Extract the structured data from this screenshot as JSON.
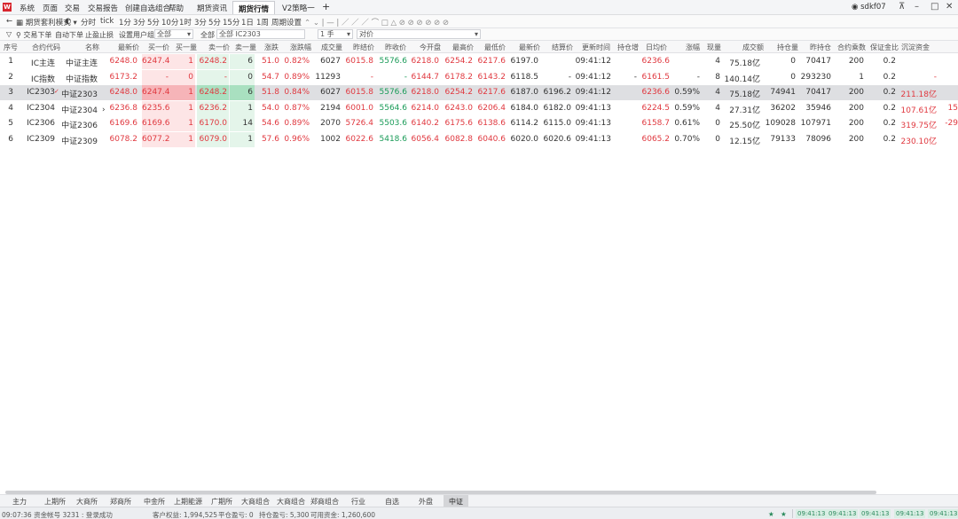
{
  "menubar": {
    "items": [
      "系统",
      "页面",
      "交易",
      "交易报告",
      "创建自选组合",
      "帮助",
      "期货资讯"
    ],
    "active_tab": "期货行情",
    "extra_tab": "V2策略一",
    "plus": "+",
    "user": "sdkf07",
    "pin_icon": "pin-icon",
    "min": "–",
    "max": "□",
    "close": "✕"
  },
  "toolbar": {
    "back": "←",
    "mode": "期货套利模式",
    "items": [
      "分时",
      "tick",
      "1分",
      "3分",
      "5分",
      "10分",
      "1时",
      "3分",
      "5分",
      "15分",
      "1日",
      "1周",
      "周期设置"
    ],
    "icons": "⌃ ⌄ | — | ／ ／ ／ ⌒ □ △ ⊘ ⊘ ⊘ ⊘ ⊘ ⊘"
  },
  "filterbar": {
    "items": [
      "交易下单",
      "自动下单",
      "止盈止损",
      "设置用户组"
    ],
    "group_value": "全部",
    "search_label": "全部",
    "search_prefix": "全部",
    "search_value": "IC2303",
    "lots_value": "1 手",
    "order_type": "对价"
  },
  "table": {
    "headers": [
      "序号",
      "合约代码",
      "名称",
      "最新价",
      "买一价",
      "买一量",
      "卖一价",
      "卖一量",
      "涨跌",
      "涨跌幅",
      "成交量",
      "昨结价",
      "昨收价",
      "今开盘",
      "最高价",
      "最低价",
      "最新价",
      "结算价",
      "更新时间",
      "持仓增",
      "日均价",
      "涨幅",
      "现量",
      "成交额",
      "持仓量",
      "昨持仓",
      "合约乘数",
      "保证金比",
      "沉淀资金"
    ],
    "rows": [
      {
        "idx": "1",
        "code": "IC主连",
        "name": "中证主连",
        "last": "6248.0",
        "bid": "6247.4",
        "bidv": "1",
        "ask": "6248.2",
        "askv": "6",
        "chg": "51.0",
        "pct": "0.82%",
        "vol": "6027",
        "presettle": "6015.8",
        "preclose": "5576.6",
        "open": "6218.0",
        "high": "6254.2",
        "low": "6217.6",
        "lastb": "6197.0",
        "settle": "",
        "time": "09:41:12",
        "oi_chg": "",
        "avg": "6236.6",
        "amp": "",
        "cur": "4",
        "turnover": "75.18亿",
        "oi": "0",
        "preoi": "70417",
        "mult": "200",
        "margin": "0.2",
        "fund": ""
      },
      {
        "idx": "2",
        "code": "IC指数",
        "name": "中证指数",
        "last": "6173.2",
        "bid": "-",
        "bidv": "0",
        "ask": "-",
        "askv": "0",
        "chg": "54.7",
        "pct": "0.89%",
        "vol": "11293",
        "presettle": "-",
        "preclose": "-",
        "open": "6144.7",
        "high": "6178.2",
        "low": "6143.2",
        "lastb": "6118.5",
        "settle": "-",
        "time": "09:41:12",
        "oi_chg": "-",
        "avg": "6161.5",
        "amp": "-",
        "cur": "8",
        "turnover": "140.14亿",
        "oi": "0",
        "preoi": "293230",
        "mult": "1",
        "margin": "0.2",
        "fund": "-"
      },
      {
        "idx": "3",
        "code": "IC2303",
        "name": "中证2303",
        "last": "6248.0",
        "bid": "6247.4",
        "bidv": "1",
        "ask": "6248.2",
        "askv": "6",
        "chg": "51.8",
        "pct": "0.84%",
        "vol": "6027",
        "presettle": "6015.8",
        "preclose": "5576.6",
        "open": "6218.0",
        "high": "6254.2",
        "low": "6217.6",
        "lastb": "6187.0",
        "settle": "6196.2",
        "time": "09:41:12",
        "oi_chg": "",
        "avg": "6236.6",
        "amp": "0.59%",
        "cur": "4",
        "turnover": "75.18亿",
        "oi": "74941",
        "preoi": "70417",
        "mult": "200",
        "margin": "0.2",
        "fund": "211.18亿"
      },
      {
        "idx": "4",
        "code": "IC2304",
        "name": "中证2304",
        "last": "6236.8",
        "bid": "6235.6",
        "bidv": "1",
        "ask": "6236.2",
        "askv": "1",
        "chg": "54.0",
        "pct": "0.87%",
        "vol": "2194",
        "presettle": "6001.0",
        "preclose": "5564.6",
        "open": "6214.0",
        "high": "6243.0",
        "low": "6206.4",
        "lastb": "6184.0",
        "settle": "6182.0",
        "time": "09:41:13",
        "oi_chg": "",
        "avg": "6224.5",
        "amp": "0.59%",
        "cur": "4",
        "turnover": "27.31亿",
        "oi": "36202",
        "preoi": "35946",
        "mult": "200",
        "margin": "0.2",
        "fund": "107.61亿",
        "extra": "15"
      },
      {
        "idx": "5",
        "code": "IC2306",
        "name": "中证2306",
        "last": "6169.6",
        "bid": "6169.6",
        "bidv": "1",
        "ask": "6170.0",
        "askv": "14",
        "chg": "54.6",
        "pct": "0.89%",
        "vol": "2070",
        "presettle": "5726.4",
        "preclose": "5503.6",
        "open": "6140.2",
        "high": "6175.6",
        "low": "6138.6",
        "lastb": "6114.2",
        "settle": "6115.0",
        "time": "09:41:13",
        "oi_chg": "",
        "avg": "6158.7",
        "amp": "0.61%",
        "cur": "0",
        "turnover": "25.50亿",
        "oi": "109028",
        "preoi": "107971",
        "mult": "200",
        "margin": "0.2",
        "fund": "319.75亿",
        "extra": "-29"
      },
      {
        "idx": "6",
        "code": "IC2309",
        "name": "中证2309",
        "last": "6078.2",
        "bid": "6077.2",
        "bidv": "1",
        "ask": "6079.0",
        "askv": "1",
        "chg": "57.6",
        "pct": "0.96%",
        "vol": "1002",
        "presettle": "6022.6",
        "preclose": "5418.6",
        "open": "6056.4",
        "high": "6082.8",
        "low": "6040.6",
        "lastb": "6020.0",
        "settle": "6020.6",
        "time": "09:41:13",
        "oi_chg": "",
        "avg": "6065.2",
        "amp": "0.70%",
        "cur": "0",
        "turnover": "12.15亿",
        "oi": "79133",
        "preoi": "78096",
        "mult": "200",
        "margin": "0.2",
        "fund": "230.10亿"
      }
    ]
  },
  "bottom_tabs": [
    "主力",
    "上期所",
    "大商所",
    "郑商所",
    "中金所",
    "上期能源",
    "广期所",
    "大商组合",
    "大商组合",
    "郑商组合",
    "行业",
    "自选",
    "外盘"
  ],
  "bottom_active_tab": "中证",
  "status": {
    "left": "09:07:36 资金帐号 3231 : 登录成功",
    "equity": "客户权益: 1,994,525",
    "pos": "平仓盈亏: 0",
    "float": "持仓盈亏: 5,300",
    "avail": "可用资金: 1,260,600",
    "clocks": [
      "09:41:13",
      "09:41:13",
      "09:41:13",
      "09:41:13"
    ]
  },
  "colors": {
    "up": "#e0383f",
    "down": "#1a9b58",
    "selected_row": "#dedfe2",
    "logo": "#d8262e"
  }
}
